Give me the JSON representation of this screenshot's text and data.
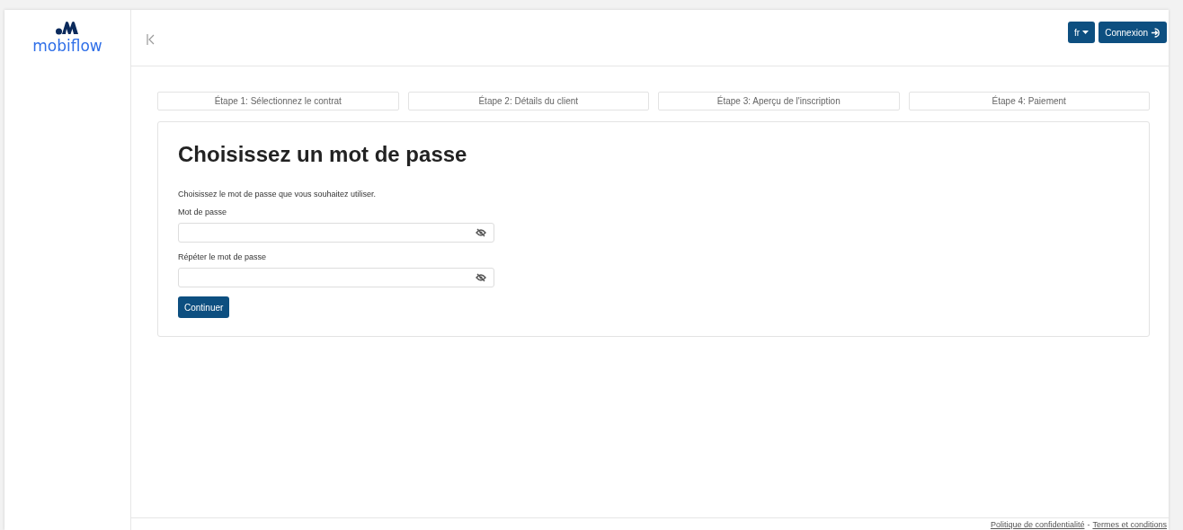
{
  "brand": {
    "name": "mobiflow"
  },
  "header": {
    "language": "fr",
    "login": "Connexion"
  },
  "steps": [
    {
      "label": "Étape 1: Sélectionnez le contrat"
    },
    {
      "label": "Étape 2: Détails du client"
    },
    {
      "label": "Étape 3: Aperçu de l'inscription"
    },
    {
      "label": "Étape 4: Paiement"
    }
  ],
  "form": {
    "title": "Choisissez un mot de passe",
    "intro": "Choisissez le mot de passe que vous souhaitez utiliser.",
    "fields": [
      {
        "label": "Mot de passe"
      },
      {
        "label": "Répéter le mot de passe"
      }
    ],
    "submit": "Continuer"
  },
  "footer": {
    "links": [
      "Politique de confidentialité",
      "Termes et conditions"
    ],
    "separator": "-"
  }
}
